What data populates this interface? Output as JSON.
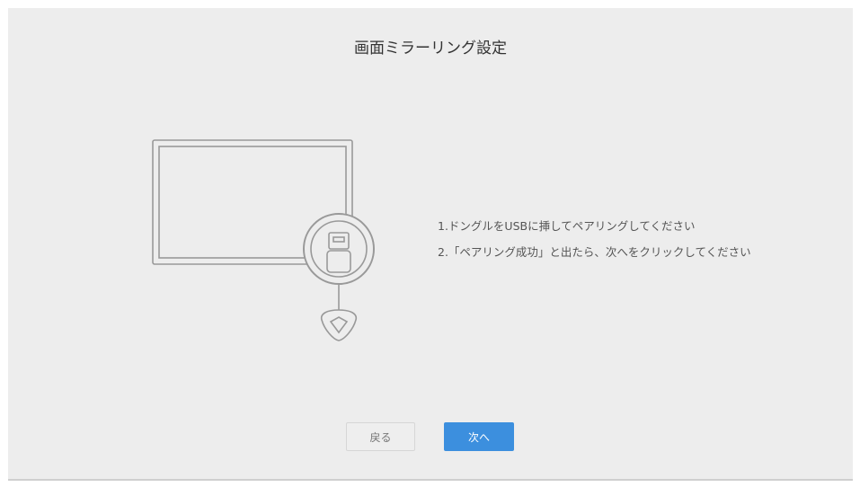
{
  "page": {
    "title": "画面ミラーリング設定"
  },
  "instructions": {
    "step1": "1.ドングルをUSBに挿してペアリングしてください",
    "step2": "2.「ペアリング成功」と出たら、次へをクリックしてください"
  },
  "buttons": {
    "back_label": "戻る",
    "next_label": "次へ"
  },
  "colors": {
    "background": "#ededed",
    "accent": "#3c8fde",
    "illustration_stroke": "#999999"
  },
  "icons": {
    "illustration": "monitor-with-usb-dongle-icon"
  }
}
